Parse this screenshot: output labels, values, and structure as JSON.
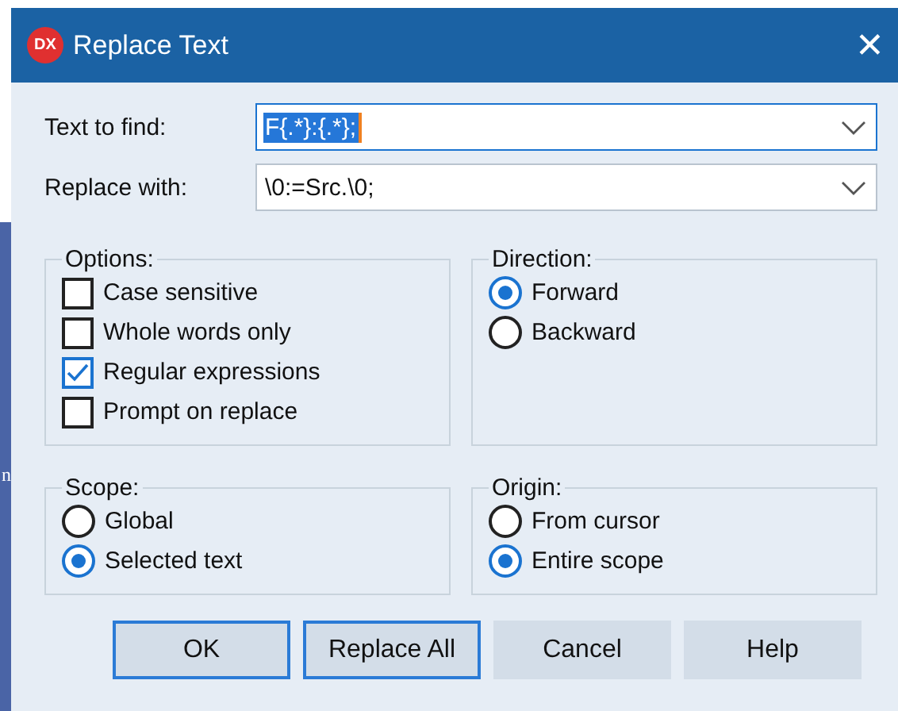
{
  "background": {
    "text": "n"
  },
  "window": {
    "title": "Replace Text",
    "logo": "DX",
    "close": "✕"
  },
  "fields": [
    {
      "label": "Text to find:",
      "value": "F{.*}:{.*};",
      "selected": true,
      "focused": true
    },
    {
      "label": "Replace with:",
      "value": "\\0:=Src.\\0;",
      "selected": false,
      "focused": false
    }
  ],
  "groups": [
    {
      "title": "Options:",
      "kind": "checkbox",
      "items": [
        {
          "label": "Case sensitive",
          "checked": false
        },
        {
          "label": "Whole words only",
          "checked": false
        },
        {
          "label": "Regular expressions",
          "checked": true
        },
        {
          "label": "Prompt on replace",
          "checked": false
        }
      ]
    },
    {
      "title": "Direction:",
      "kind": "radio",
      "items": [
        {
          "label": "Forward",
          "selected": true
        },
        {
          "label": "Backward",
          "selected": false
        }
      ]
    },
    {
      "title": "Scope:",
      "kind": "radio",
      "items": [
        {
          "label": "Global",
          "selected": false
        },
        {
          "label": "Selected text",
          "selected": true
        }
      ]
    },
    {
      "title": "Origin:",
      "kind": "radio",
      "items": [
        {
          "label": "From cursor",
          "selected": false
        },
        {
          "label": "Entire scope",
          "selected": true
        }
      ]
    }
  ],
  "buttons": [
    {
      "label": "OK",
      "default": true
    },
    {
      "label": "Replace All",
      "default": true
    },
    {
      "label": "Cancel",
      "default": false
    },
    {
      "label": "Help",
      "default": false
    }
  ]
}
